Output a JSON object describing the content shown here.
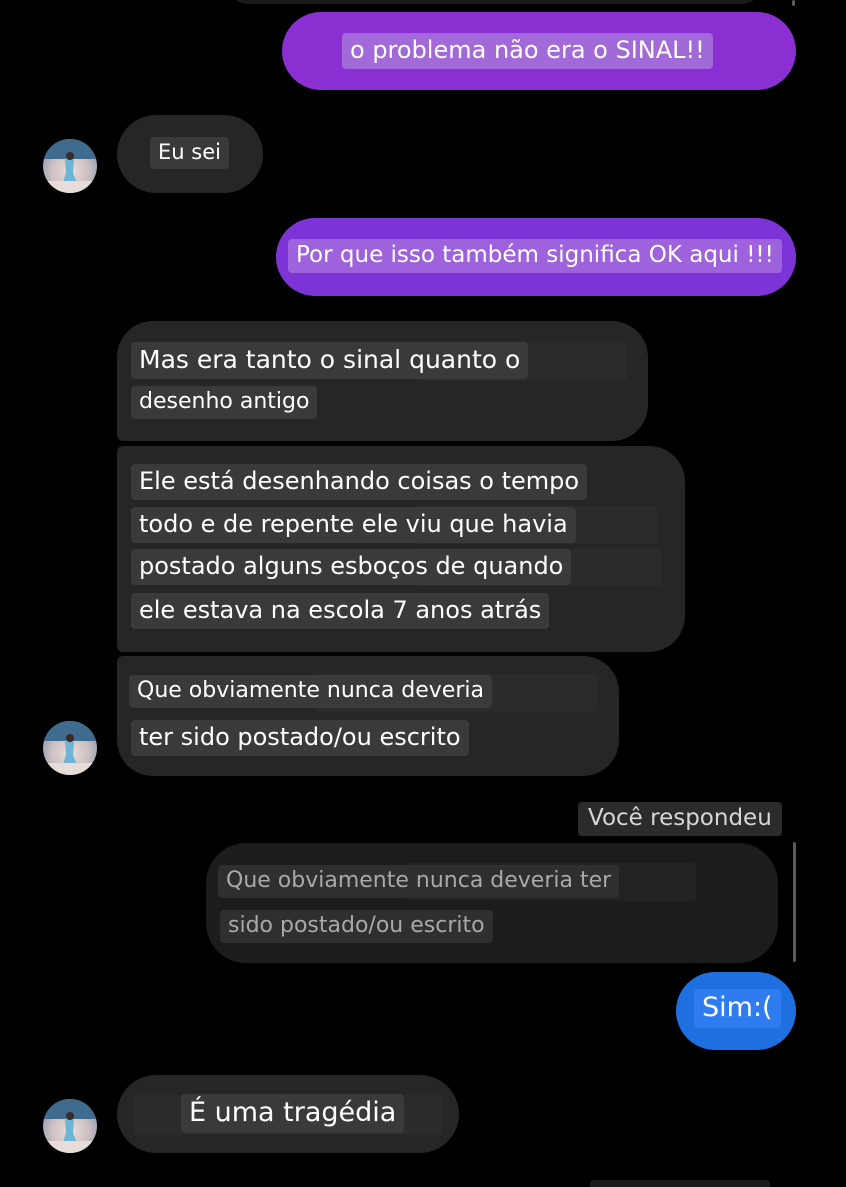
{
  "messages": {
    "m1": "o problema não era o SINAL!!",
    "m2": "Eu sei",
    "m3": "Por que isso também significa OK aqui !!!",
    "m4": [
      "Mas era tanto o sinal quanto o",
      "desenho antigo"
    ],
    "m5": [
      "Ele está desenhando coisas o tempo",
      "todo e de repente ele viu que havia",
      "postado alguns esboços de quando",
      "ele estava na escola 7 anos atrás"
    ],
    "m6": [
      "Que obviamente nunca deveria",
      "ter sido postado/ou escrito"
    ],
    "reply_label": "Você respondeu",
    "quoted": [
      "Que obviamente nunca deveria ter",
      "sido postado/ou escrito"
    ],
    "m7": "Sim:(",
    "m8": "É uma tragédia"
  },
  "colors": {
    "outgoing_purple": "#8a2fd1",
    "outgoing_blue": "#1e6fe0",
    "incoming_gray": "#262626",
    "background": "#000000"
  },
  "icons": {
    "avatar": "contact-avatar-photo"
  }
}
